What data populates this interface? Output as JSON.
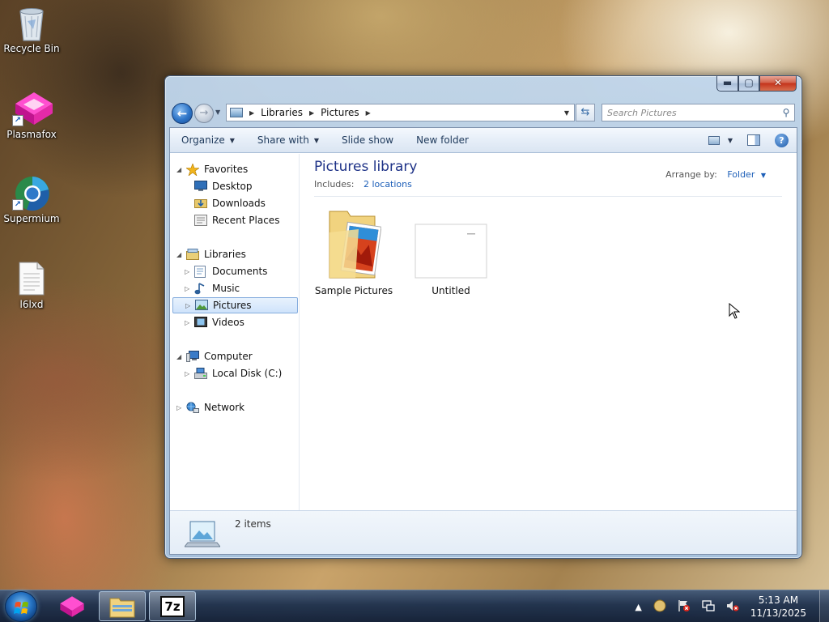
{
  "desktop": {
    "icons": [
      {
        "label": "Recycle Bin",
        "icon": "recycle-bin-icon"
      },
      {
        "label": "Plasmafox",
        "icon": "plasmafox-icon"
      },
      {
        "label": "Supermium",
        "icon": "supermium-icon"
      },
      {
        "label": "l6lxd",
        "icon": "text-file-icon"
      }
    ]
  },
  "window": {
    "caption": {
      "minimize": "▬",
      "maximize": "▢",
      "close": "✕"
    },
    "address": {
      "crumbs": [
        "Libraries",
        "Pictures"
      ]
    },
    "search": {
      "placeholder": "Search Pictures"
    },
    "toolbar": {
      "organize": "Organize",
      "share_with": "Share with",
      "slide_show": "Slide show",
      "new_folder": "New folder",
      "help": "?"
    },
    "nav": {
      "favorites": "Favorites",
      "desktop": "Desktop",
      "downloads": "Downloads",
      "recent_places": "Recent Places",
      "libraries": "Libraries",
      "documents": "Documents",
      "music": "Music",
      "pictures": "Pictures",
      "videos": "Videos",
      "computer": "Computer",
      "local_disk": "Local Disk (C:)",
      "network": "Network"
    },
    "content": {
      "title": "Pictures library",
      "includes_label": "Includes:",
      "includes_link": "2 locations",
      "arrange_label": "Arrange by:",
      "arrange_value": "Folder",
      "items": [
        {
          "name": "Sample Pictures",
          "icon": "folder-pictures-icon"
        },
        {
          "name": "Untitled",
          "icon": "image-file-icon"
        }
      ]
    },
    "details": {
      "count": "2 items"
    }
  },
  "taskbar": {
    "clock_time": "5:13 AM",
    "clock_date": "11/13/2025",
    "seven_zip_label": "7z",
    "tray_chevron": "▲"
  },
  "colors": {
    "library_title": "#1e3287",
    "link": "#1d5fb8",
    "taskbar": "#1c304e"
  }
}
